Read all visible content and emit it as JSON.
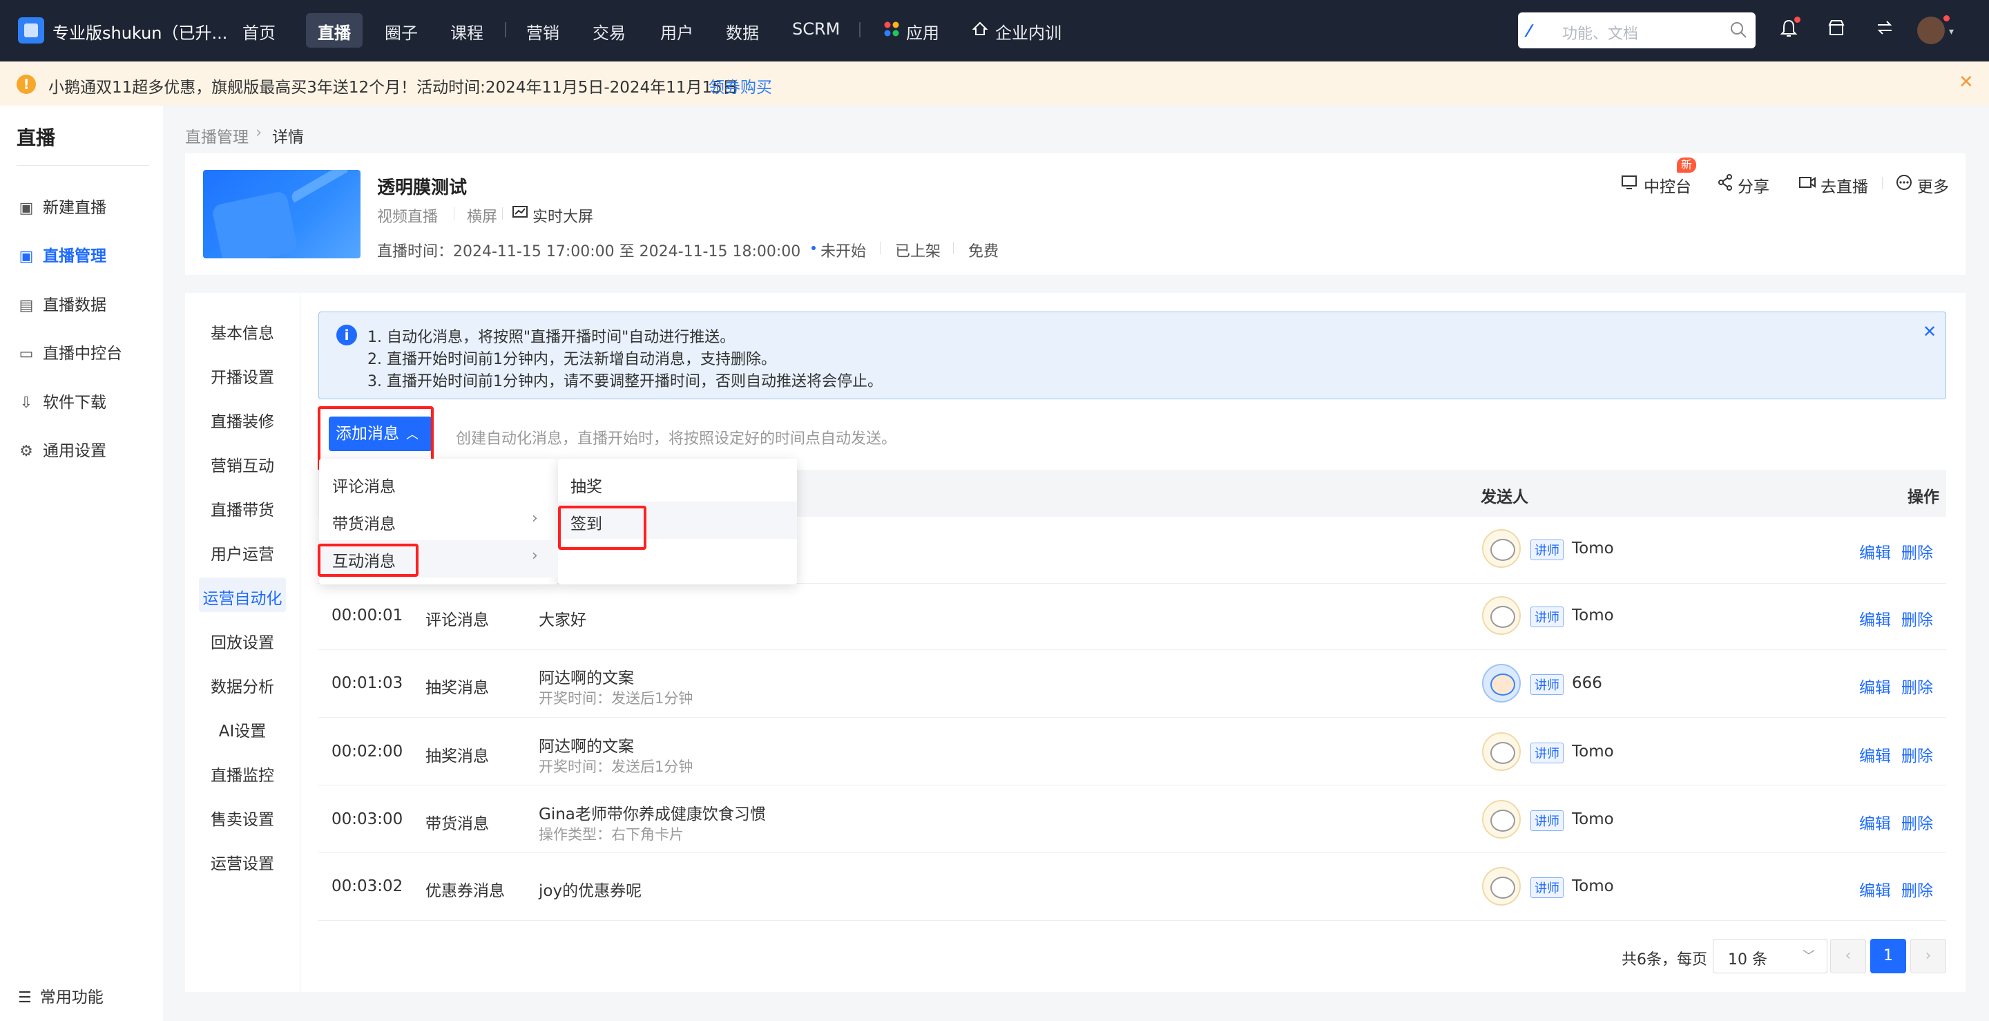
{
  "org": {
    "name": "专业版shukun（已升..."
  },
  "nav": {
    "items": [
      "首页",
      "直播",
      "圈子",
      "课程",
      "营销",
      "交易",
      "用户",
      "数据",
      "SCRM",
      "应用",
      "企业内训"
    ],
    "active": "直播"
  },
  "search": {
    "placeholder": "功能、文档"
  },
  "banner": {
    "text": "小鹅通双11超多优惠，旗舰版最高买3年送12个月！活动时间:2024年11月5日-2024年11月15日",
    "link": "领券购买"
  },
  "sidebar": {
    "title": "直播",
    "items": [
      "新建直播",
      "直播管理",
      "直播数据",
      "直播中控台",
      "软件下载",
      "通用设置"
    ],
    "active": "直播管理",
    "bottom": "常用功能"
  },
  "breadcrumb": {
    "parent": "直播管理",
    "current": "详情"
  },
  "live": {
    "title": "透明膜测试",
    "type": "视频直播",
    "orientation": "横屏",
    "screen": "实时大屏",
    "time": "直播时间：2024-11-15 17:00:00 至 2024-11-15 18:00:00",
    "status": "未开始",
    "shelf": "已上架",
    "price": "免费"
  },
  "header_actions": {
    "console": "中控台",
    "badge": "新",
    "share": "分享",
    "go_live": "去直播",
    "more": "更多"
  },
  "inner_nav": {
    "items": [
      "基本信息",
      "开播设置",
      "直播装修",
      "营销互动",
      "直播带货",
      "用户运营",
      "运营自动化",
      "回放设置",
      "数据分析",
      "AI设置",
      "直播监控",
      "售卖设置",
      "运营设置"
    ],
    "active": "运营自动化"
  },
  "alert": {
    "lines": [
      "1. 自动化消息，将按照\"直播开播时间\"自动进行推送。",
      "2. 直播开始时间前1分钟内，无法新增自动消息，支持删除。",
      "3. 直播开始时间前1分钟内，请不要调整开播时间，否则自动推送将会停止。"
    ]
  },
  "toolbar": {
    "add_label": "添加消息",
    "hint": "创建自动化消息，直播开始时，将按照设定好的时间点自动发送。"
  },
  "dropdown": {
    "level1": [
      "评论消息",
      "带货消息",
      "互动消息"
    ],
    "level2": [
      "抽奖",
      "签到"
    ]
  },
  "table": {
    "headers": {
      "sender": "发送人",
      "ops": "操作"
    },
    "edit": "编辑",
    "delete": "删除",
    "lecturer_tag": "讲师",
    "rows": [
      {
        "time": "",
        "type": "",
        "content": "",
        "sub": "",
        "sender": "Tomo"
      },
      {
        "time": "00:00:01",
        "type": "评论消息",
        "content": "大家好",
        "sub": "",
        "sender": "Tomo"
      },
      {
        "time": "00:01:03",
        "type": "抽奖消息",
        "content": "阿达啊的文案",
        "sub": "开奖时间：发送后1分钟",
        "sender": "666"
      },
      {
        "time": "00:02:00",
        "type": "抽奖消息",
        "content": "阿达啊的文案",
        "sub": "开奖时间：发送后1分钟",
        "sender": "Tomo"
      },
      {
        "time": "00:03:00",
        "type": "带货消息",
        "content": "Gina老师带你养成健康饮食习惯",
        "sub": "操作类型：右下角卡片",
        "sender": "Tomo"
      },
      {
        "time": "00:03:02",
        "type": "优惠券消息",
        "content": "joy的优惠券呢",
        "sub": "",
        "sender": "Tomo"
      }
    ]
  },
  "pagination": {
    "total": "共6条，每页",
    "page_size": "10 条",
    "current": "1"
  },
  "colors": {
    "primary": "#1f6bff",
    "topbar": "#1d2433",
    "highlight": "#ff2020",
    "banner_bg": "#fdf4e6"
  }
}
